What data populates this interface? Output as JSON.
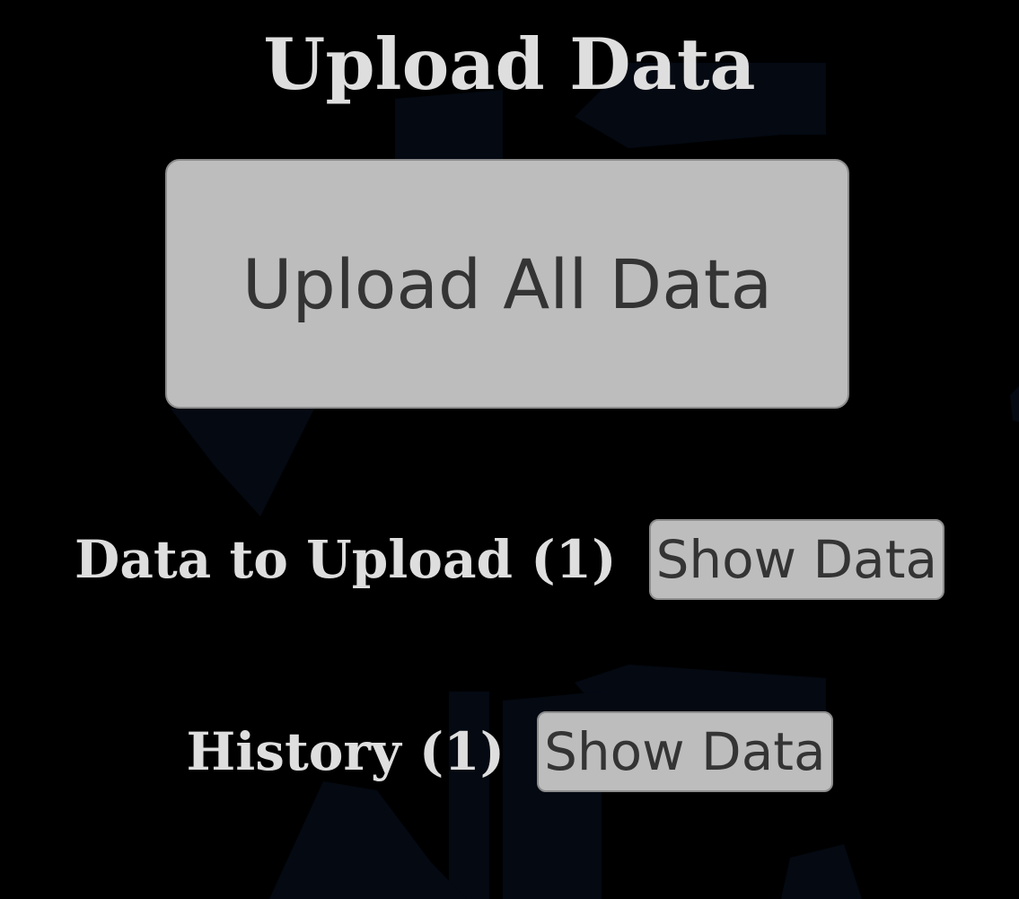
{
  "page": {
    "title": "Upload Data"
  },
  "upload_all": {
    "label": "Upload All Data"
  },
  "data_to_upload": {
    "label": "Data to Upload (1)",
    "button_label": "Show Data"
  },
  "history": {
    "label": "History (1)",
    "button_label": "Show Data"
  },
  "colors": {
    "background": "#000000",
    "text": "#dedede",
    "button_bg": "#bdbdbd",
    "button_text": "#343434",
    "watermark": "#050a12"
  },
  "icons": {
    "background_watermark": "cloud-upload-watermark-icon"
  }
}
